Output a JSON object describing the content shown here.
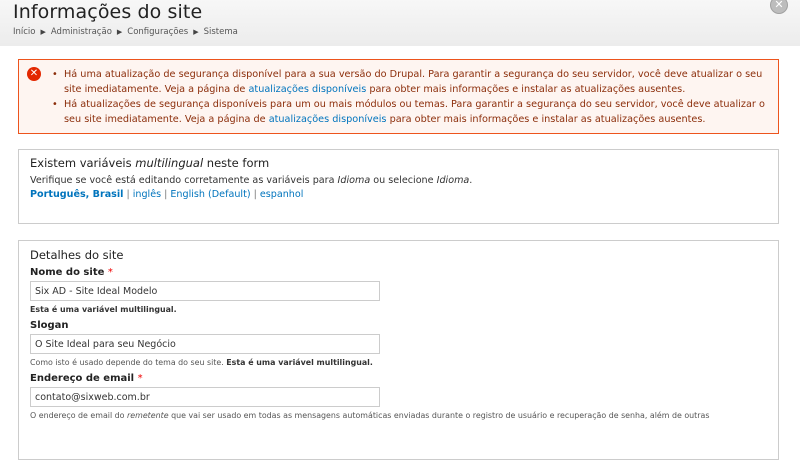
{
  "header": {
    "title": "Informações do site",
    "breadcrumb": [
      "Início",
      "Administração",
      "Configurações",
      "Sistema"
    ],
    "close_icon": "close-icon"
  },
  "messages": {
    "error_icon": "error-icon",
    "items": [
      {
        "before": "Há uma atualização de segurança disponível para a sua versão do Drupal. Para garantir a segurança do seu servidor, você deve atualizar o seu site imediatamente. Veja a página de ",
        "link": "atualizações disponíveis",
        "after": " para obter mais informações e instalar as atualizações ausentes."
      },
      {
        "before": "Há atualizações de segurança disponíveis para um ou mais módulos ou temas. Para garantir a segurança do seu servidor, você deve atualizar o seu site imediatamente. Veja a página de ",
        "link": "atualizações disponíveis",
        "after": " para obter mais informações e instalar as atualizações ausentes."
      }
    ]
  },
  "i18n_panel": {
    "title_before": "Existem variáveis ",
    "title_em": "multilingual",
    "title_after": " neste form",
    "desc_before": "Verifique se você está editando corretamente as variáveis para ",
    "desc_em1": "Idioma",
    "desc_mid": " ou selecione ",
    "desc_em2": "Idioma",
    "desc_end": ".",
    "languages": [
      "Português, Brasil",
      "inglês",
      "English (Default)",
      "espanhol"
    ],
    "separator": "|"
  },
  "site_panel": {
    "legend": "Detalhes do site",
    "required_mark": "*",
    "name": {
      "label": "Nome do site",
      "value": "Six AD - Site Ideal Modelo",
      "desc": "Esta é uma variável multilingual."
    },
    "slogan": {
      "label": "Slogan",
      "value": "O Site Ideal para seu Negócio",
      "desc": "Como isto é usado depende do tema do seu site.",
      "desc_bold": "Esta é uma variável multilingual."
    },
    "email": {
      "label": "Endereço de email",
      "value": "contato@sixweb.com.br",
      "desc_before": "O endereço de email do ",
      "desc_em": "remetente",
      "desc_after": " que vai ser usado em todas as mensagens automáticas enviadas durante o registro de usuário e recuperação de senha, além de outras"
    }
  }
}
